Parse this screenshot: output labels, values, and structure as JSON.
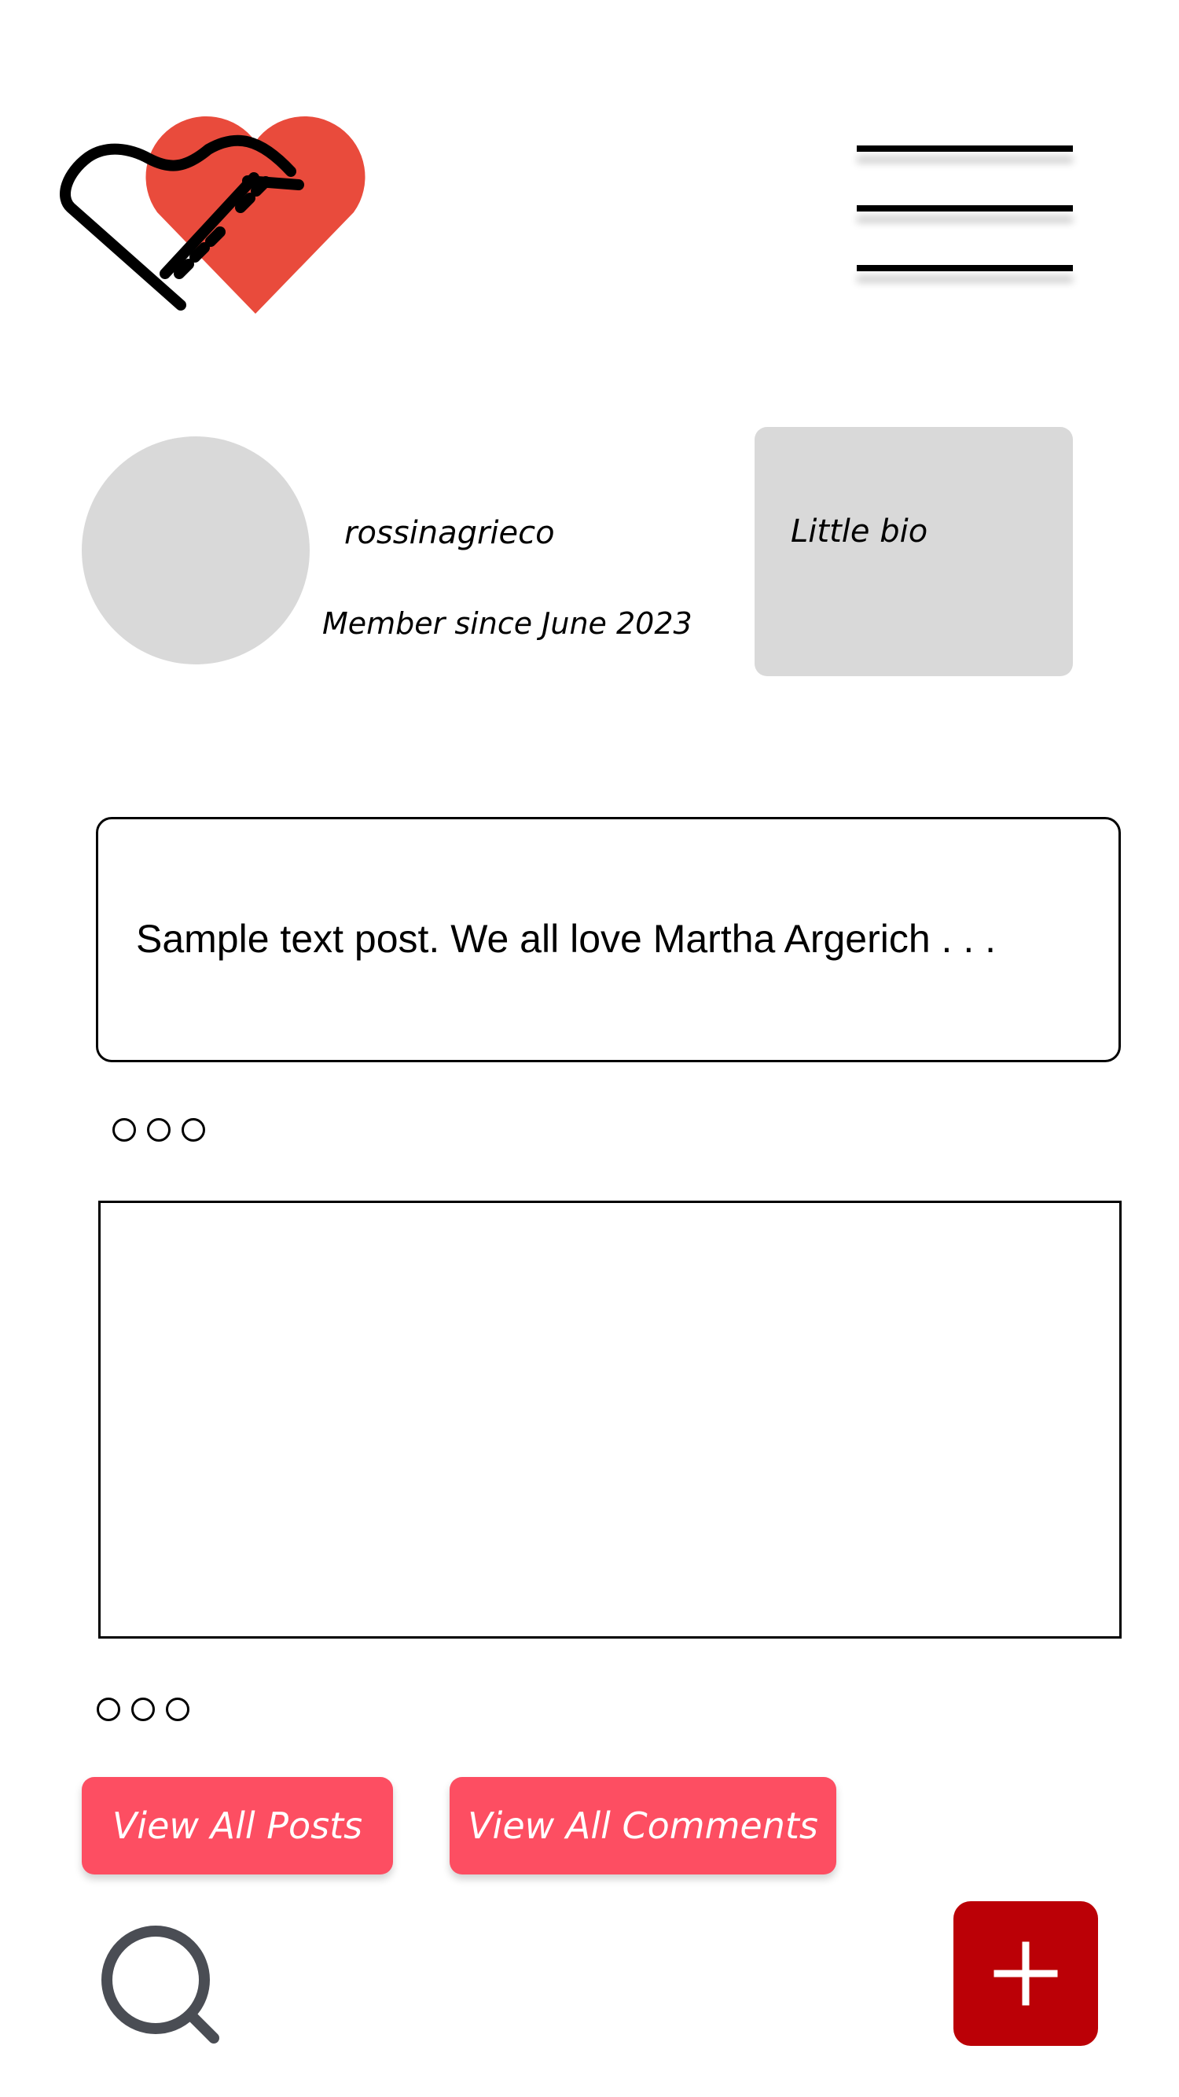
{
  "header": {
    "logo_icon": "heart-piano-logo",
    "menu_icon": "hamburger-menu-icon"
  },
  "profile": {
    "username": "rossinagrieco",
    "member_since": "Member since June 2023",
    "bio": "Little bio"
  },
  "posts": [
    {
      "type": "text",
      "text": "Sample text post. We all love Martha Argerich . . ."
    },
    {
      "type": "media"
    }
  ],
  "actions": {
    "view_all_posts": "View All Posts",
    "view_all_comments": "View All Comments"
  },
  "footer": {
    "search_icon": "search-icon",
    "add_icon": "plus-icon"
  },
  "colors": {
    "logo_heart": "#e94b3c",
    "button_bg": "#fd4e62",
    "add_button_bg": "#bb0006",
    "placeholder_gray": "#d9d9d9",
    "search_icon": "#4a4d54"
  }
}
